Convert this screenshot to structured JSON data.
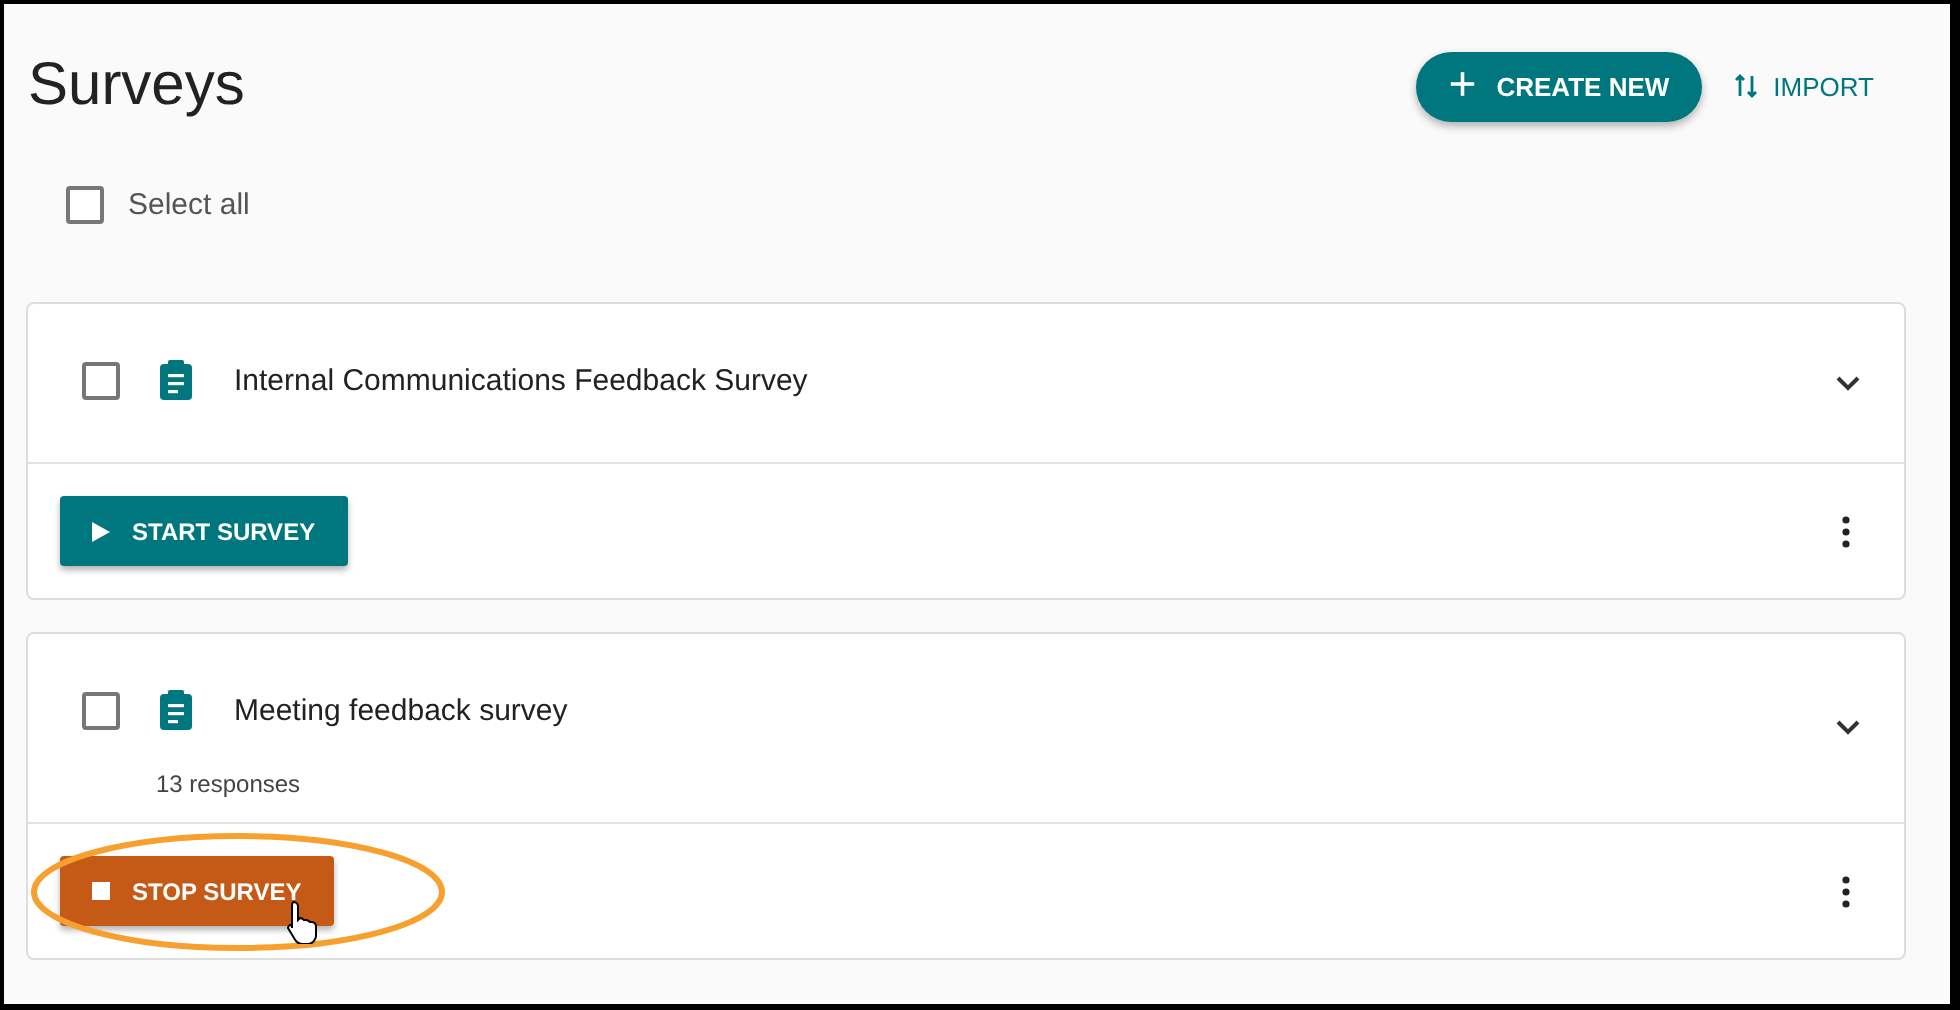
{
  "header": {
    "title": "Surveys",
    "create_button": {
      "icon": "+",
      "label": "CREATE NEW"
    },
    "import_button": {
      "label": "IMPORT"
    }
  },
  "select_all": {
    "label": "Select all",
    "checked": false
  },
  "surveys": [
    {
      "title": "Internal Communications Feedback Survey",
      "checked": false,
      "action": {
        "kind": "start",
        "label": "START SURVEY"
      },
      "highlighted": false
    },
    {
      "title": "Meeting feedback survey",
      "responses": "13 responses",
      "checked": false,
      "action": {
        "kind": "stop",
        "label": "STOP SURVEY"
      },
      "highlighted": true
    }
  ]
}
